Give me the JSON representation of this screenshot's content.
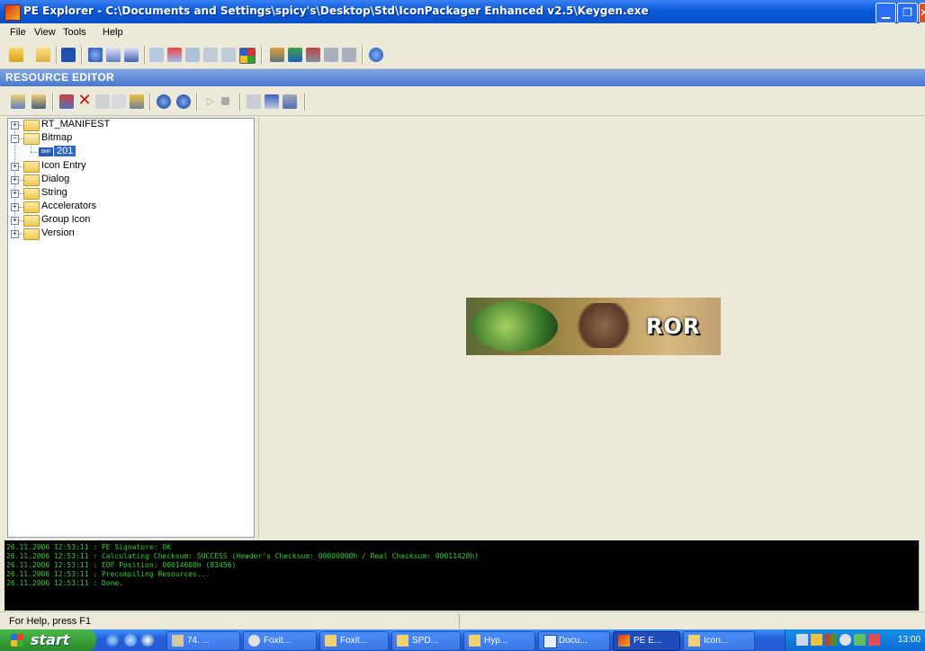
{
  "window": {
    "title": "PE Explorer - C:\\Documents and Settings\\spicy's\\Desktop\\Std\\IconPackager Enhanced v2.5\\Keygen.exe"
  },
  "menu": {
    "items": [
      {
        "label": "File"
      },
      {
        "label": "View"
      },
      {
        "label": "Tools"
      },
      {
        "label": "Help"
      }
    ]
  },
  "resource_editor": {
    "label": "RESOURCE EDITOR"
  },
  "tree": {
    "items": [
      {
        "label": "RT_MANIFEST",
        "expanded": false
      },
      {
        "label": "Bitmap",
        "expanded": true
      },
      {
        "label": "201",
        "selected": true
      },
      {
        "label": "Icon Entry",
        "expanded": false
      },
      {
        "label": "Dialog",
        "expanded": false
      },
      {
        "label": "String",
        "expanded": false
      },
      {
        "label": "Accelerators",
        "expanded": false
      },
      {
        "label": "Group Icon",
        "expanded": false
      },
      {
        "label": "Version",
        "expanded": false
      }
    ],
    "bmp_badge": "BMP"
  },
  "preview": {
    "banner_text": "ROR"
  },
  "log": {
    "lines": [
      "26.11.2006 12:53:11 : PE Signature: OK",
      "26.11.2006 12:53:11 : Calculating Checksum: SUCCESS (Header's Checksum: 00000000h / Real Checksum: 00011428h)",
      "26.11.2006 12:53:11 : EOF Position: 00014600h  (83456)",
      "26.11.2006 12:53:11 : Precompiling Resources...",
      "26.11.2006 12:53:11 : Done."
    ]
  },
  "status": {
    "text": "For Help, press F1"
  },
  "taskbar": {
    "start_label": "start",
    "tasks": [
      {
        "label": "74. ..."
      },
      {
        "label": "Foxit..."
      },
      {
        "label": "Foxit..."
      },
      {
        "label": "SPD..."
      },
      {
        "label": "Hyp..."
      },
      {
        "label": "Docu..."
      },
      {
        "label": "PE E..."
      },
      {
        "label": "Icon..."
      }
    ],
    "clock": "13:00"
  },
  "colors": {
    "log_text": "#2bd42b",
    "titlebar": "#0a5ad8",
    "selection": "#316ac5"
  }
}
